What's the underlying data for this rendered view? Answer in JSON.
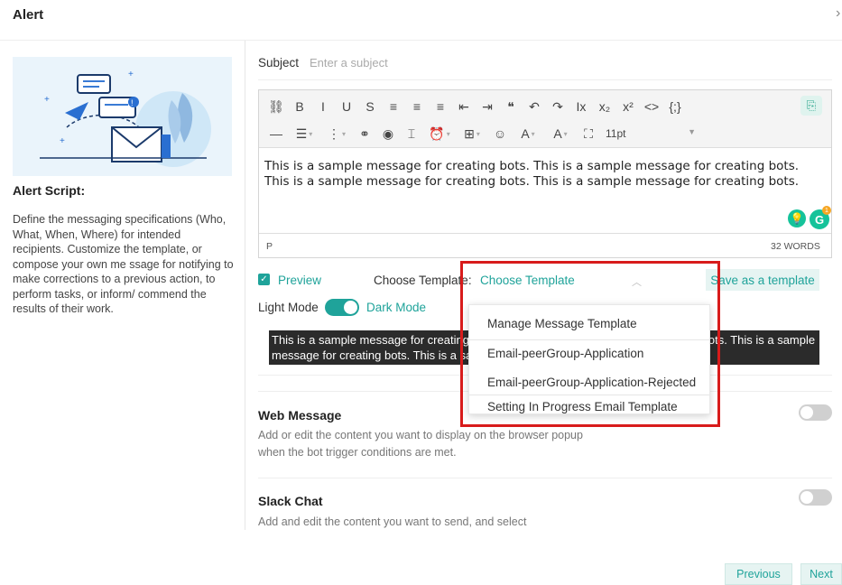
{
  "header": {
    "title": "Alert",
    "close_glyph": "›"
  },
  "left_panel": {
    "title": "Alert Script:",
    "description": "Define the messaging specifications (Who, What, When, Where) for intended recipients. Customize the template, or compose your own me ssage for notifying to make corrections to a previous action, to perform tasks, or inform/ commend the results of their work."
  },
  "subject": {
    "label": "Subject",
    "placeholder": "Enter a subject",
    "value": ""
  },
  "editor": {
    "toolbar_row1": [
      {
        "icon": "binoculars-icon",
        "glyph": "⛓"
      },
      {
        "icon": "bold-icon",
        "glyph": "B"
      },
      {
        "icon": "italic-icon",
        "glyph": "I"
      },
      {
        "icon": "underline-icon",
        "glyph": "U"
      },
      {
        "icon": "strikethrough-icon",
        "glyph": "S"
      },
      {
        "icon": "align-left-icon",
        "glyph": "≡"
      },
      {
        "icon": "align-center-icon",
        "glyph": "≡"
      },
      {
        "icon": "align-right-icon",
        "glyph": "≡"
      },
      {
        "icon": "outdent-icon",
        "glyph": "⇤"
      },
      {
        "icon": "indent-icon",
        "glyph": "⇥"
      },
      {
        "icon": "quote-icon",
        "glyph": "❝"
      },
      {
        "icon": "undo-icon",
        "glyph": "↶"
      },
      {
        "icon": "redo-icon",
        "glyph": "↷"
      },
      {
        "icon": "clear-format-icon",
        "glyph": "Ix"
      },
      {
        "icon": "subscript-icon",
        "glyph": "x₂"
      },
      {
        "icon": "superscript-icon",
        "glyph": "x²"
      },
      {
        "icon": "code-icon",
        "glyph": "<>"
      },
      {
        "icon": "variable-icon",
        "glyph": "{;}"
      }
    ],
    "toolbar_row2": [
      {
        "icon": "horizontal-rule-icon",
        "glyph": "—",
        "caret": false
      },
      {
        "icon": "bullet-list-icon",
        "glyph": "☰",
        "caret": true
      },
      {
        "icon": "numbered-list-icon",
        "glyph": "⋮",
        "caret": true
      },
      {
        "icon": "link-icon",
        "glyph": "⚭",
        "caret": false
      },
      {
        "icon": "preview-eye-icon",
        "glyph": "◉",
        "caret": false
      },
      {
        "icon": "page-break-icon",
        "glyph": "⌶",
        "caret": false
      },
      {
        "icon": "alarm-clock-icon",
        "glyph": "⏰",
        "caret": true
      },
      {
        "icon": "table-icon",
        "glyph": "⊞",
        "caret": true
      },
      {
        "icon": "emoji-icon",
        "glyph": "☺",
        "caret": false
      },
      {
        "icon": "text-color-icon",
        "glyph": "A",
        "caret": true
      },
      {
        "icon": "background-color-icon",
        "glyph": "A",
        "caret": true
      },
      {
        "icon": "fullscreen-icon",
        "glyph": "⛶",
        "caret": false
      }
    ],
    "font_size": "11pt",
    "grammar_icon_glyph": "⎘",
    "body_text": "This is a sample message for creating bots. This is a sample message for creating bots.  This is a sample message for creating bots. This is a sample message for creating bots.",
    "grammarly_bulb": "💡",
    "grammarly_g": "G",
    "grammarly_count": "1",
    "status_path": "P",
    "word_count": "32 WORDS"
  },
  "options": {
    "preview_label": "Preview",
    "preview_checked": true,
    "choose_template_label": "Choose Template:",
    "choose_template_value": "Choose Template",
    "save_template_label": "Save as a template",
    "light_mode_label": "Light Mode",
    "dark_mode_label": "Dark Mode",
    "dark_mode_enabled": true
  },
  "preview_text": "This is a sample message for creating bots. This is a sample message for creating bots.  This is a sample message for creating bots. This is a sample message for creating bots.",
  "template_dropdown": {
    "items": [
      "Manage Message Template",
      "Email-peerGroup-Application",
      "Email-peerGroup-Application-Rejected",
      "Setting In Progress Email Template"
    ],
    "highlight_color": "#d81b1b"
  },
  "web_message": {
    "title": "Web Message",
    "description": "Add or edit the content you want to display on the browser popup when the bot trigger conditions are met.",
    "enabled": false
  },
  "slack_chat": {
    "title": "Slack Chat",
    "description": "Add and edit the content you want to send, and select",
    "enabled": false
  },
  "footer": {
    "previous_label": "Previous",
    "next_label": "Next"
  },
  "colors": {
    "accent": "#1fa39a",
    "accent_bg": "#e6f4f2",
    "dark_preview_bg": "#2b2b2b"
  }
}
